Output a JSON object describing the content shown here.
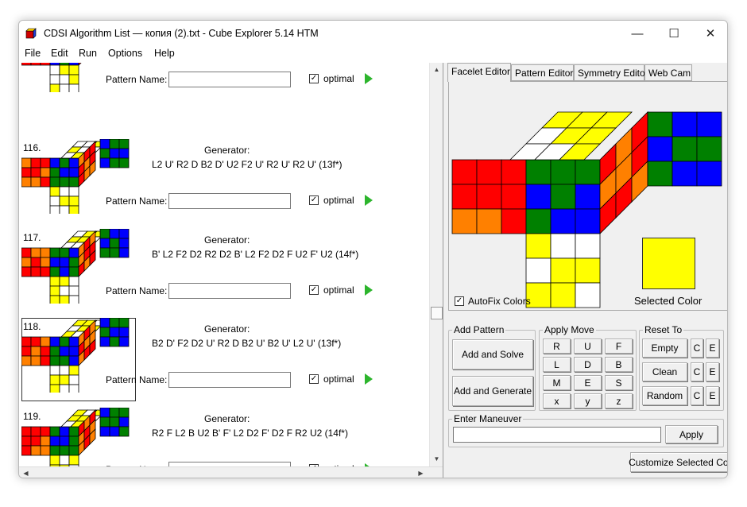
{
  "window": {
    "title": "CDSI Algorithm List — копия (2).txt - Cube Explorer 5.14 HTM",
    "minimize": "—",
    "maximize": "☐",
    "close": "✕"
  },
  "menu": [
    "File",
    "Edit",
    "Run",
    "Options",
    "Help"
  ],
  "colors": {
    "red": "#ff0000",
    "orange": "#ff8000",
    "green": "#008000",
    "blue": "#0000ff",
    "yellow": "#ffff00",
    "white": "#ffffff",
    "play": "#2db52d"
  },
  "list": {
    "generator_label": "Generator:",
    "pattern_name_label": "Pattern Name:",
    "optimal_label": "optimal",
    "entries": [
      {
        "num": "",
        "moves": "",
        "pattern_name": ""
      },
      {
        "num": "116.",
        "moves": "L2 U' R2 D B2 D' U2 F2 U' R2 U' R2 U'  (13f*)",
        "pattern_name": ""
      },
      {
        "num": "117.",
        "moves": "B' L2 F2 D2 R2 D2 B' L2 F2 D2 F U2 F' U2  (14f*)",
        "pattern_name": ""
      },
      {
        "num": "118.",
        "moves": "B2 D' F2 D2 U' R2 D B2 U' B2 U' L2 U'  (13f*)",
        "pattern_name": ""
      },
      {
        "num": "119.",
        "moves": "R2 F L2 B U2 B' F' L2 D2 F' D2 F R2 U2  (14f*)",
        "pattern_name": ""
      }
    ]
  },
  "tabs": [
    "Facelet Editor",
    "Pattern Editor",
    "Symmetry Editor",
    "Web Cam"
  ],
  "facelet": {
    "autofix_label": "AutoFix Colors",
    "selected_color_label": "Selected Color",
    "selected_color": "#ffff00"
  },
  "add_pattern": {
    "title": "Add Pattern",
    "add_solve": "Add and Solve",
    "add_generate": "Add and Generate"
  },
  "apply_move": {
    "title": "Apply Move",
    "buttons": [
      "R",
      "U",
      "F",
      "L",
      "D",
      "B",
      "M",
      "E",
      "S",
      "x",
      "y",
      "z"
    ]
  },
  "reset_to": {
    "title": "Reset To",
    "empty": "Empty",
    "clean": "Clean",
    "random": "Random",
    "c": "C",
    "e": "E"
  },
  "maneuver": {
    "title": "Enter Maneuver",
    "value": "",
    "apply": "Apply"
  },
  "customize_color": "Customize Selected Color"
}
